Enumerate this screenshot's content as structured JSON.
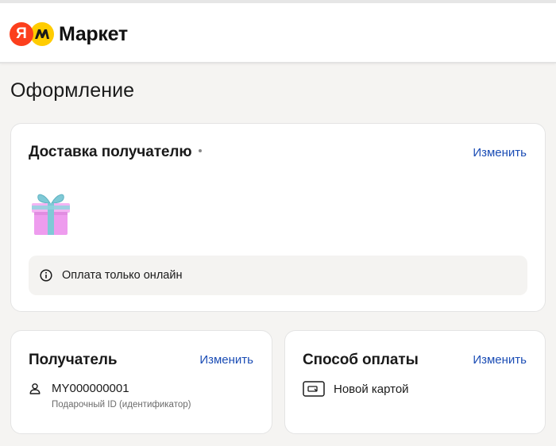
{
  "header": {
    "logo_badge": "Я",
    "logo_text": "Маркет"
  },
  "page": {
    "title": "Оформление"
  },
  "delivery": {
    "title": "Доставка получателю",
    "change_label": "Изменить",
    "notice": "Оплата только онлайн",
    "icons": {
      "gift": "gift-box-icon",
      "info": "info-icon"
    }
  },
  "recipient": {
    "title": "Получатель",
    "change_label": "Изменить",
    "id_value": "MY000000001",
    "id_caption": "Подарочный ID (идентификатор)",
    "icon": "person-icon"
  },
  "payment": {
    "title": "Способ оплаты",
    "change_label": "Изменить",
    "method": "Новой картой",
    "icon": "card-icon"
  },
  "colors": {
    "link": "#1b4db5",
    "logo_red": "#fc3f1d",
    "logo_yellow": "#ffcc00",
    "gift_pink": "#f0a6f0",
    "gift_ribbon": "#7fc9d6"
  }
}
